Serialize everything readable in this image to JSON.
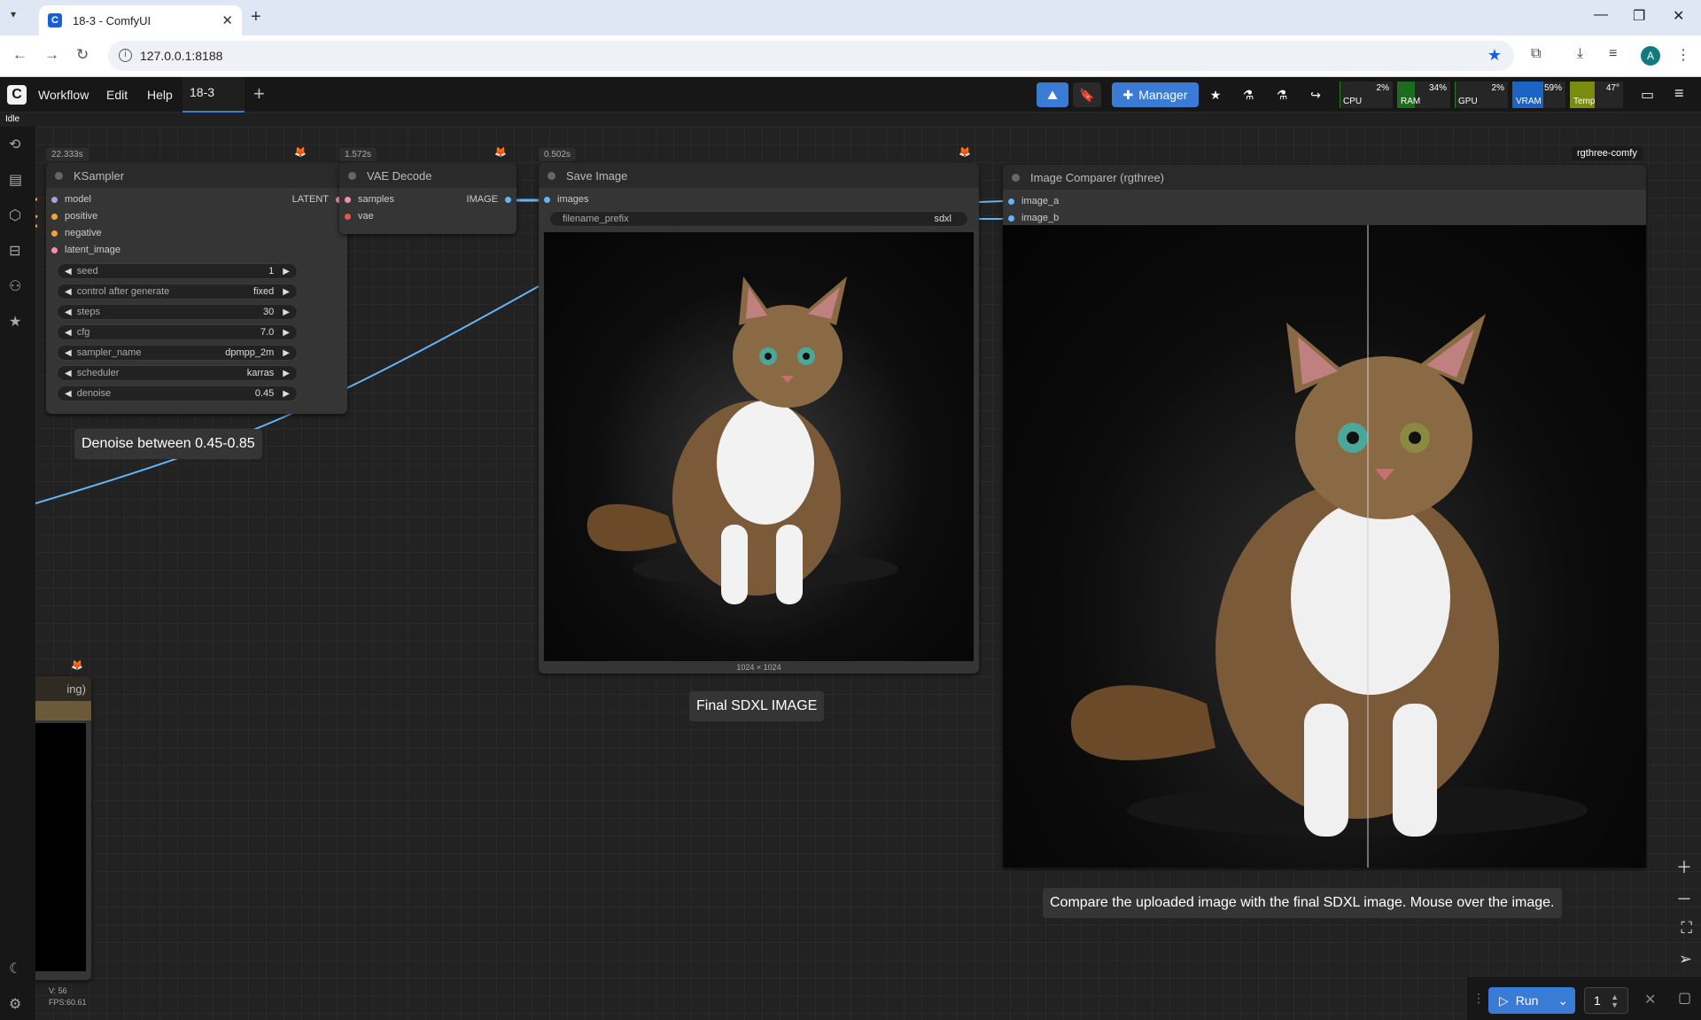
{
  "browser": {
    "tab_title": "18-3 - ComfyUI",
    "url": "127.0.0.1:8188",
    "avatar_letter": "A"
  },
  "menu": {
    "items": [
      "Workflow",
      "Edit",
      "Help"
    ],
    "workflow_tab": "18-3",
    "manager_label": "Manager"
  },
  "monitor": {
    "cpu": {
      "label": "CPU",
      "value": "2%",
      "level": 0.02
    },
    "ram": {
      "label": "RAM",
      "value": "34%",
      "level": 0.34
    },
    "gpu": {
      "label": "GPU",
      "value": "2%",
      "level": 0.02
    },
    "vram": {
      "label": "VRAM",
      "value": "59%",
      "level": 0.59
    },
    "temp": {
      "label": "Temp",
      "value": "47°",
      "level": 0.47
    }
  },
  "status": "Idle",
  "nodes": {
    "ksampler": {
      "title": "KSampler",
      "time": "22.333s",
      "inputs": [
        "model",
        "positive",
        "negative",
        "latent_image"
      ],
      "output": "LATENT",
      "widgets": [
        {
          "name": "seed",
          "value": "1"
        },
        {
          "name": "control after generate",
          "value": "fixed"
        },
        {
          "name": "steps",
          "value": "30"
        },
        {
          "name": "cfg",
          "value": "7.0"
        },
        {
          "name": "sampler_name",
          "value": "dpmpp_2m"
        },
        {
          "name": "scheduler",
          "value": "karras"
        },
        {
          "name": "denoise",
          "value": "0.45"
        }
      ]
    },
    "vae_decode": {
      "title": "VAE Decode",
      "time": "1.572s",
      "inputs": [
        "samples",
        "vae"
      ],
      "output": "IMAGE"
    },
    "save_image": {
      "title": "Save Image",
      "time": "0.502s",
      "input": "images",
      "widget_name": "filename_prefix",
      "widget_value": "sdxl",
      "image_size": "1024 × 1024"
    },
    "comparer": {
      "title": "Image Comparer (rgthree)",
      "tag": "rgthree-comfy",
      "inputs": [
        "image_a",
        "image_b"
      ]
    },
    "partial": {
      "title": "ing)"
    }
  },
  "notes": {
    "denoise": "Denoise between 0.45-0.85",
    "final": "Final SDXL IMAGE",
    "compare": "Compare the uploaded image with the final SDXL image. Mouse over the image."
  },
  "stats": {
    "v": "V: 56",
    "fps": "FPS:60.61"
  },
  "run": {
    "label": "Run",
    "count": "1"
  }
}
